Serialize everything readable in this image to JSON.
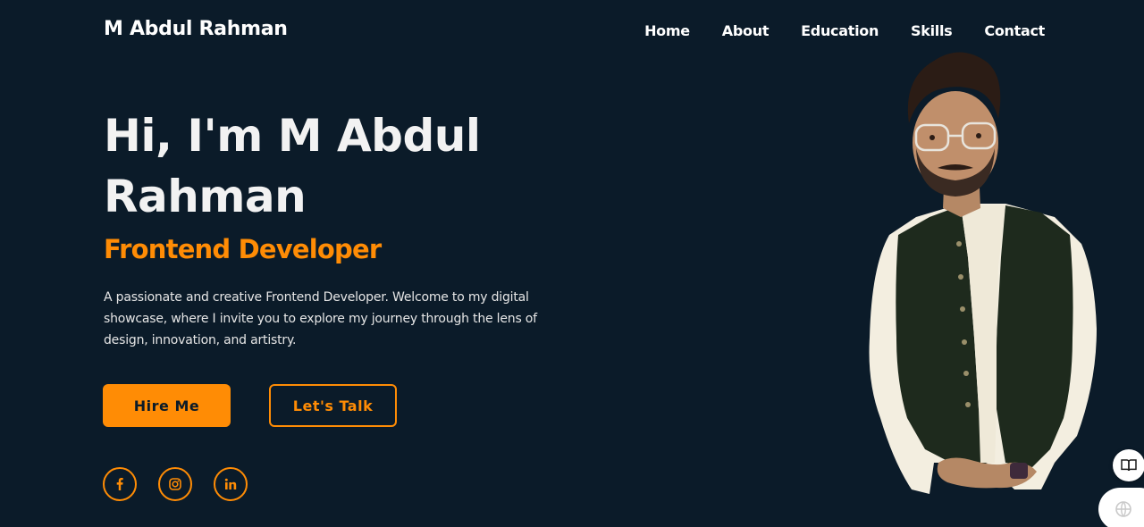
{
  "header": {
    "logo": "M Abdul Rahman",
    "nav": [
      "Home",
      "About",
      "Education",
      "Skills",
      "Contact"
    ]
  },
  "hero": {
    "title": "Hi, I'm M Abdul Rahman",
    "subtitle": "Frontend Developer",
    "description": "A passionate and creative Frontend Developer. Welcome to my digital showcase, where I invite you to explore my journey through the lens of design, innovation, and artistry.",
    "hire_label": "Hire Me",
    "talk_label": "Let's Talk"
  },
  "social": [
    {
      "icon": "facebook-icon"
    },
    {
      "icon": "instagram-icon"
    },
    {
      "icon": "linkedin-icon"
    }
  ],
  "colors": {
    "background": "#0b1b29",
    "accent": "#ff8c05",
    "text": "#ffffff"
  }
}
